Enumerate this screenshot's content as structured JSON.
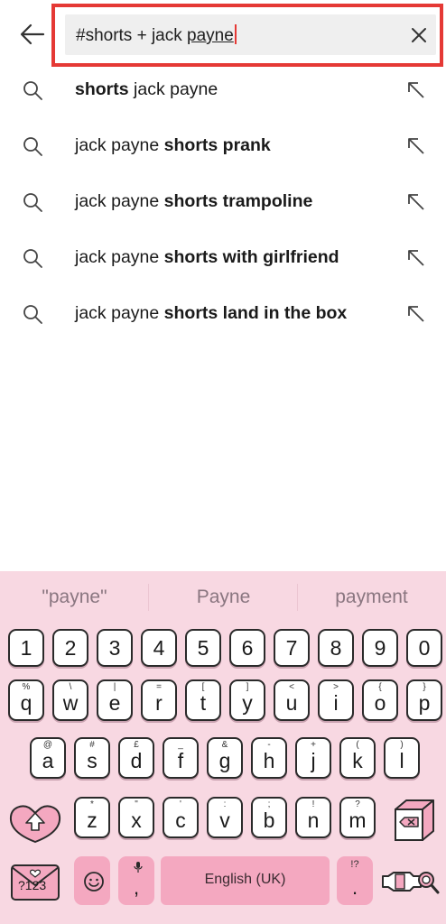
{
  "search": {
    "query_prefix": "#shorts + jack ",
    "query_suffix": "payne"
  },
  "suggestions": [
    {
      "plain": "",
      "bold": "shorts",
      "tail": " jack payne"
    },
    {
      "plain": "jack payne ",
      "bold": "shorts prank",
      "tail": ""
    },
    {
      "plain": "jack payne ",
      "bold": "shorts trampoline",
      "tail": ""
    },
    {
      "plain": "jack payne ",
      "bold": "shorts with girlfriend",
      "tail": ""
    },
    {
      "plain": "jack payne ",
      "bold": "shorts land in the box",
      "tail": ""
    }
  ],
  "keyboard": {
    "candidates": [
      "\"payne\"",
      "Payne",
      "payment"
    ],
    "numbers": [
      "1",
      "2",
      "3",
      "4",
      "5",
      "6",
      "7",
      "8",
      "9",
      "0"
    ],
    "row1": [
      {
        "k": "q",
        "s": "%"
      },
      {
        "k": "w",
        "s": "\\"
      },
      {
        "k": "e",
        "s": "|"
      },
      {
        "k": "r",
        "s": "="
      },
      {
        "k": "t",
        "s": "["
      },
      {
        "k": "y",
        "s": "]"
      },
      {
        "k": "u",
        "s": "<"
      },
      {
        "k": "i",
        "s": ">"
      },
      {
        "k": "o",
        "s": "{"
      },
      {
        "k": "p",
        "s": "}"
      }
    ],
    "row2": [
      {
        "k": "a",
        "s": "@"
      },
      {
        "k": "s",
        "s": "#"
      },
      {
        "k": "d",
        "s": "£"
      },
      {
        "k": "f",
        "s": "_"
      },
      {
        "k": "g",
        "s": "&"
      },
      {
        "k": "h",
        "s": "-"
      },
      {
        "k": "j",
        "s": "+"
      },
      {
        "k": "k",
        "s": "("
      },
      {
        "k": "l",
        "s": ")"
      }
    ],
    "row3": [
      {
        "k": "z",
        "s": "*"
      },
      {
        "k": "x",
        "s": "\""
      },
      {
        "k": "c",
        "s": "'"
      },
      {
        "k": "v",
        "s": ":"
      },
      {
        "k": "b",
        "s": ";"
      },
      {
        "k": "n",
        "s": "!"
      },
      {
        "k": "m",
        "s": "?"
      }
    ],
    "symbols_label": "?123",
    "comma": ",",
    "period": ".",
    "period_sub": "!?",
    "space_label": "English (UK)"
  },
  "colors": {
    "highlight": "#e53935",
    "keyboard_bg": "#f8d8e2",
    "accent_pink": "#f4a8c0"
  }
}
